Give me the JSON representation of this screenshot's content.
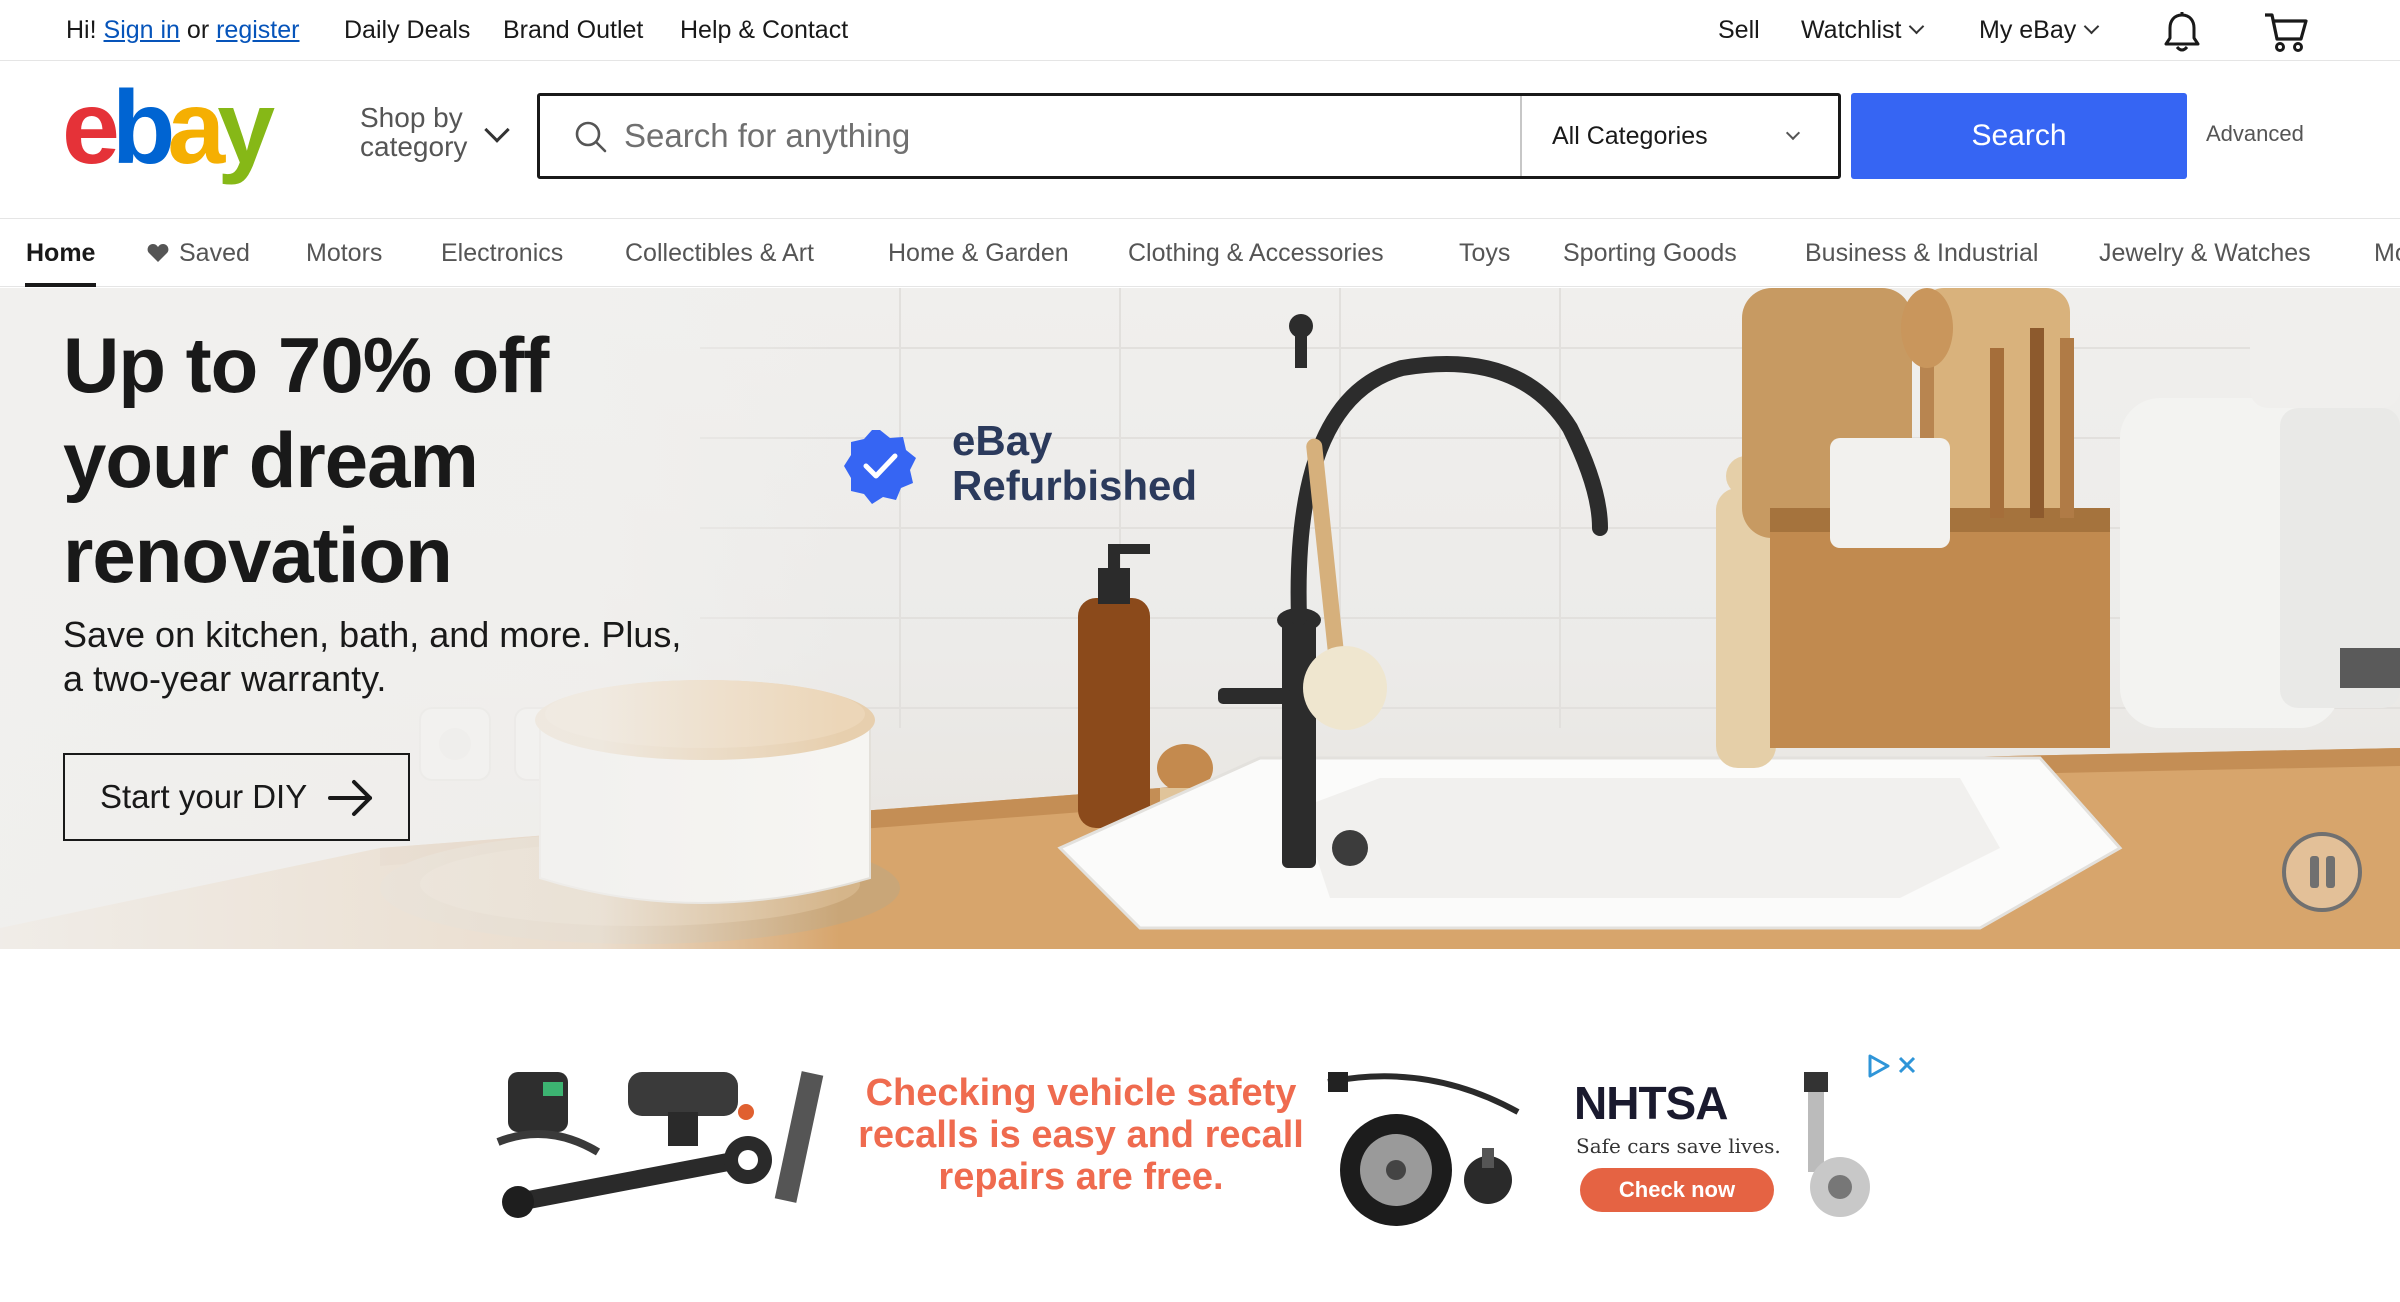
{
  "topbar": {
    "greeting": "Hi!",
    "sign_in": "Sign in",
    "or": "or",
    "register": "register",
    "links": [
      "Daily Deals",
      "Brand Outlet",
      "Help & Contact"
    ],
    "sell": "Sell",
    "watchlist": "Watchlist",
    "my_ebay": "My eBay"
  },
  "header": {
    "shop_by_category": "Shop by category",
    "search_placeholder": "Search for anything",
    "category_select": "All Categories",
    "search_button": "Search",
    "advanced": "Advanced"
  },
  "nav": {
    "items": [
      "Home",
      "Saved",
      "Motors",
      "Electronics",
      "Collectibles & Art",
      "Home & Garden",
      "Clothing & Accessories",
      "Toys",
      "Sporting Goods",
      "Business & Industrial",
      "Jewelry & Watches",
      "Mo"
    ]
  },
  "hero": {
    "headline": "Up to 70% off your dream renovation",
    "subtext": "Save on kitchen, bath, and more. Plus, a two-year warranty.",
    "cta": "Start your DIY",
    "badge_line1": "eBay",
    "badge_line2": "Refurbished"
  },
  "ad": {
    "headline": "Checking vehicle safety recalls is easy and recall repairs are free.",
    "brand": "NHTSA",
    "tagline": "Safe cars save lives.",
    "cta": "Check now"
  },
  "colors": {
    "primary": "#3665f3",
    "link": "#0654ba",
    "ad_orange": "#ef6b4f",
    "logo_red": "#e53238",
    "logo_blue": "#0064d2",
    "logo_yellow": "#f5af02",
    "logo_green": "#86b817"
  }
}
